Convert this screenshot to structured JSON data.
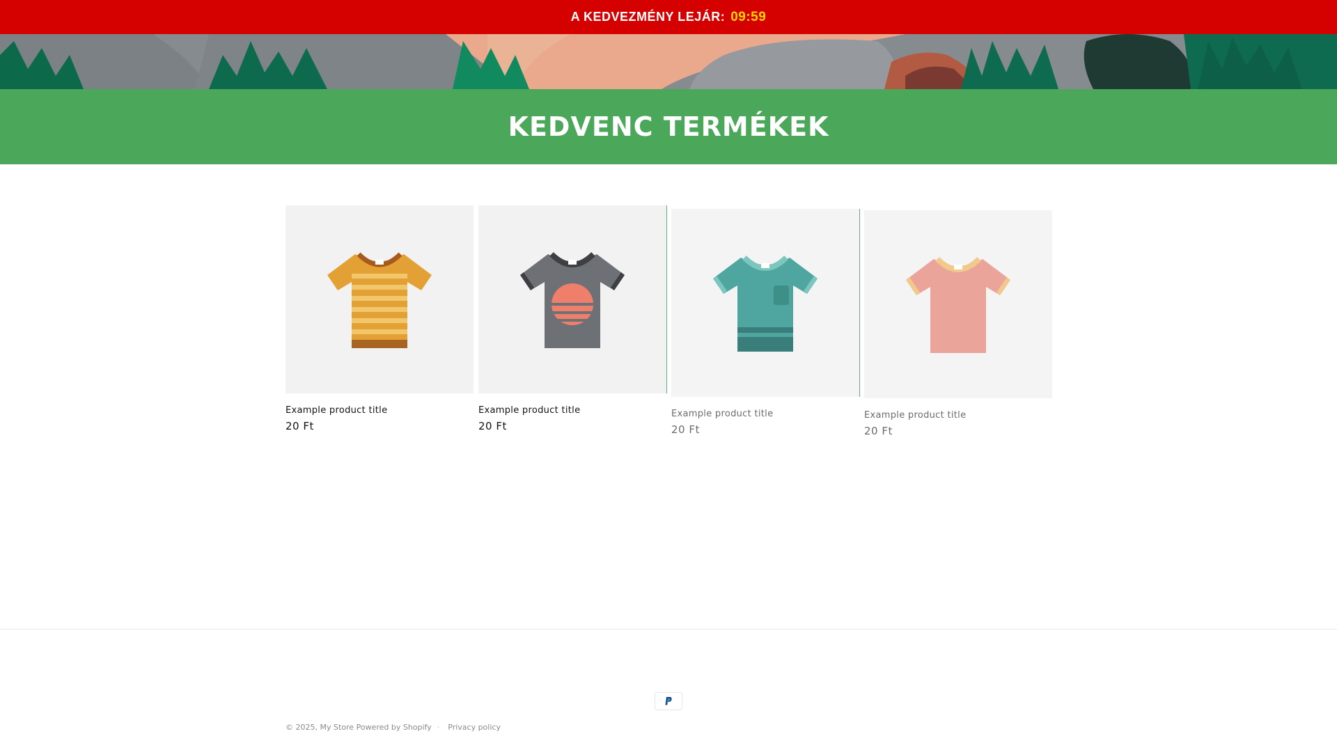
{
  "announcement": {
    "label": "A KEDVEZMÉNY LEJÁR:",
    "timer": "09:59",
    "background_color": "#d50000",
    "timer_color": "#ffd400"
  },
  "collection": {
    "title": "KEDVENC TERMÉKEK",
    "header_color": "#4ba75a"
  },
  "products": [
    {
      "title": "Example product title",
      "price": "20 Ft",
      "icon": "striped-orange-tshirt-icon"
    },
    {
      "title": "Example product title",
      "price": "20 Ft",
      "icon": "gray-sunset-tshirt-icon"
    },
    {
      "title": "Example product title",
      "price": "20 Ft",
      "icon": "teal-pocket-tshirt-icon"
    },
    {
      "title": "Example product title",
      "price": "20 Ft",
      "icon": "pink-tshirt-icon"
    }
  ],
  "footer": {
    "copyright_prefix": "© 2025,",
    "store_name": "My Store",
    "powered_by": "Powered by Shopify",
    "privacy": "Privacy policy",
    "payment_icon": "paypal-icon"
  }
}
